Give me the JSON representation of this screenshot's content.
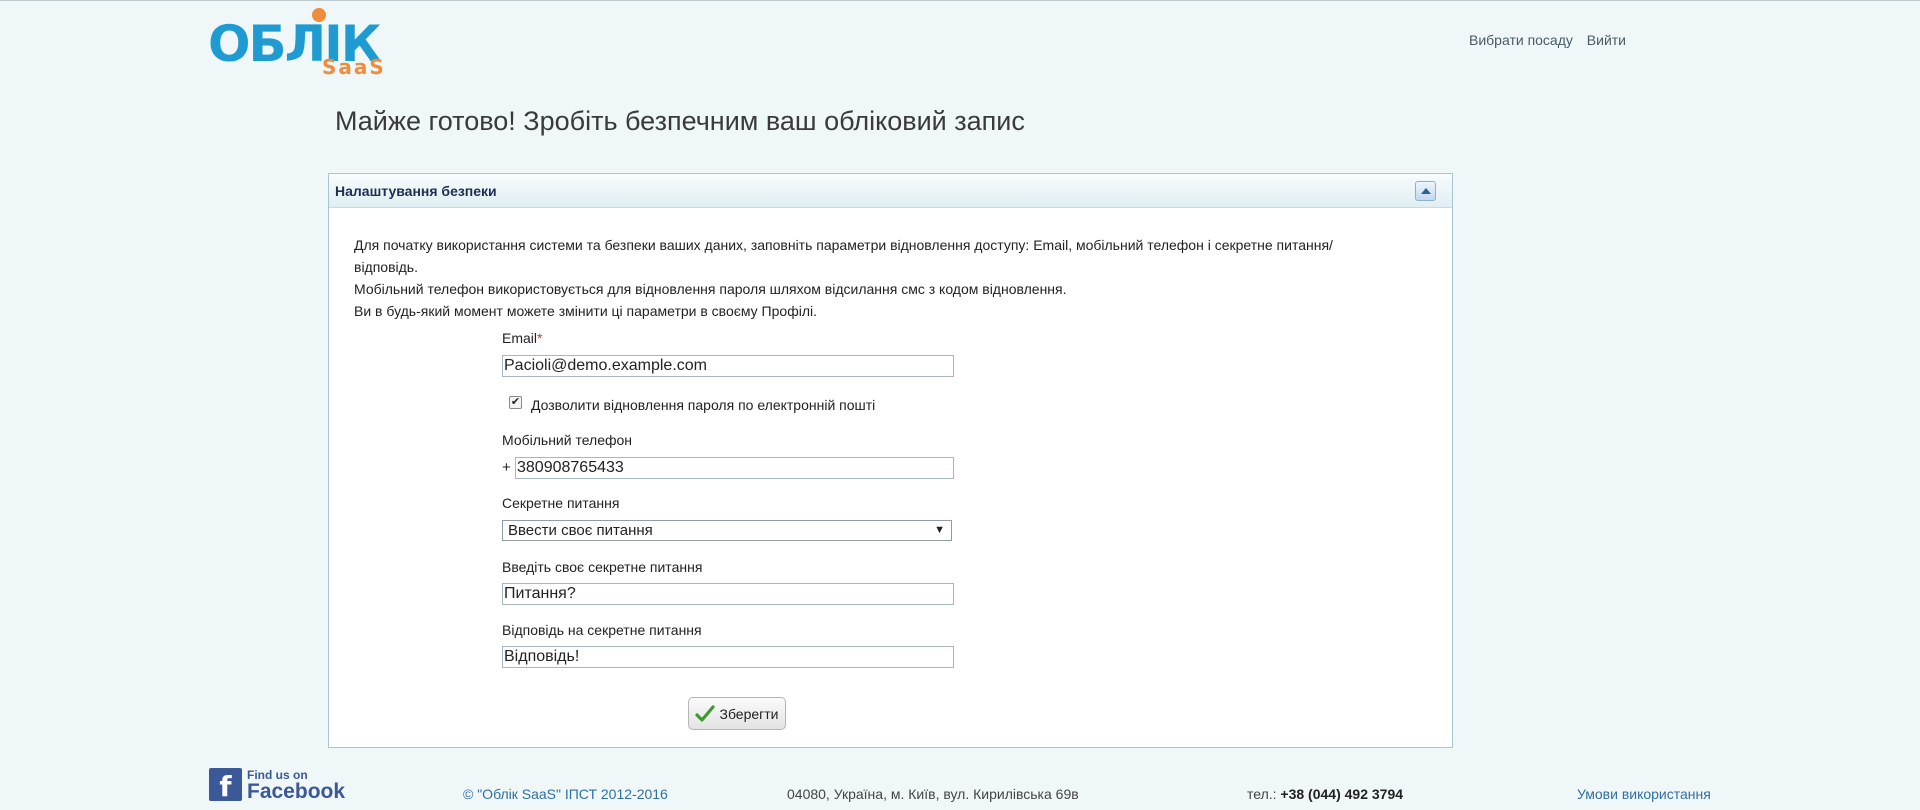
{
  "header": {
    "logo_main": "ОБЛІК",
    "logo_sub": "SaaS",
    "nav": {
      "choose_position": "Вибрати посаду",
      "logout": "Вийти"
    }
  },
  "page_title": "Майже готово! Зробіть безпечним ваш обліковий запис",
  "panel": {
    "title": "Налаштування безпеки",
    "intro": [
      "Для початку використання системи та безпеки ваших даних, заповніть параметри відновлення доступу: Email, мобільний телефон і секретне питання/",
      "відповідь.",
      "Мобільний телефон використовується для відновлення пароля шляхом відсилання смс з кодом відновлення.",
      "Ви в будь-який момент можете змінити ці параметри в своєму Профілі."
    ],
    "email": {
      "label": "Email",
      "required_mark": "*",
      "value": "Pacioli@demo.example.com"
    },
    "allow_email_recovery": {
      "label": "Дозволити відновлення пароля по електронній пошті",
      "checked": true,
      "mark": "✔"
    },
    "phone": {
      "label": "Мобільний телефон",
      "prefix": "+",
      "value": "380908765433"
    },
    "secret_question_type": {
      "label": "Секретне питання",
      "selected": "Ввести своє питання",
      "arrow": "▼"
    },
    "custom_question": {
      "label": "Введіть своє секретне питання",
      "value": "Питання?"
    },
    "answer": {
      "label": "Відповідь на секретне питання",
      "value": "Відповідь!"
    },
    "save_label": "Зберегти"
  },
  "footer": {
    "fb_glyph": "f",
    "fb_find": "Find us on",
    "fb_name": "Facebook",
    "copyright": "© \"Облік SaaS\" ІПСТ 2012-2016",
    "address": "04080, Україна, м. Київ, вул. Кирилівська 69в",
    "tel_label": "тел.:",
    "tel_number": "+38 (044) 492 3794",
    "terms": "Умови використання"
  },
  "colors": {
    "background": "#eff7f8",
    "logo_blue": "#1f9bd1",
    "logo_orange": "#ef8c3d",
    "link_blue": "#2f6fa3",
    "panel_border": "#a9c5cf",
    "facebook": "#3b5998"
  }
}
